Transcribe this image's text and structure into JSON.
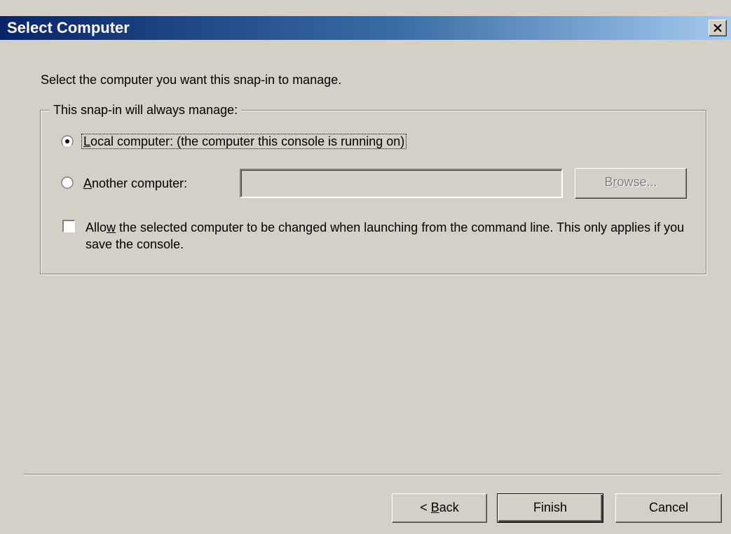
{
  "dialog": {
    "title": "Select Computer"
  },
  "instruction": "Select the computer you want this snap-in to manage.",
  "group": {
    "legend": "This snap-in will always manage:",
    "local_option": {
      "mnemonic": "L",
      "label_rest": "ocal computer:  (the computer this console is running on)",
      "selected": true
    },
    "another_option": {
      "mnemonic": "A",
      "label_rest": "nother computer:",
      "selected": false,
      "value": ""
    },
    "browse_button": {
      "pre": "B",
      "mnemonic": "r",
      "post": "owse...",
      "enabled": false
    },
    "allow_checkbox": {
      "pre": "Allo",
      "mnemonic": "w",
      "post": " the selected computer to be changed when launching from the command line.  This only applies if you save the console.",
      "checked": false
    }
  },
  "footer": {
    "back_button": {
      "pre": "< ",
      "mnemonic": "B",
      "post": "ack"
    },
    "finish_label": "Finish",
    "cancel_label": "Cancel"
  },
  "icons": {
    "close": "close-icon",
    "radio_selected": "radio-selected-icon",
    "radio_unselected": "radio-unselected-icon"
  }
}
